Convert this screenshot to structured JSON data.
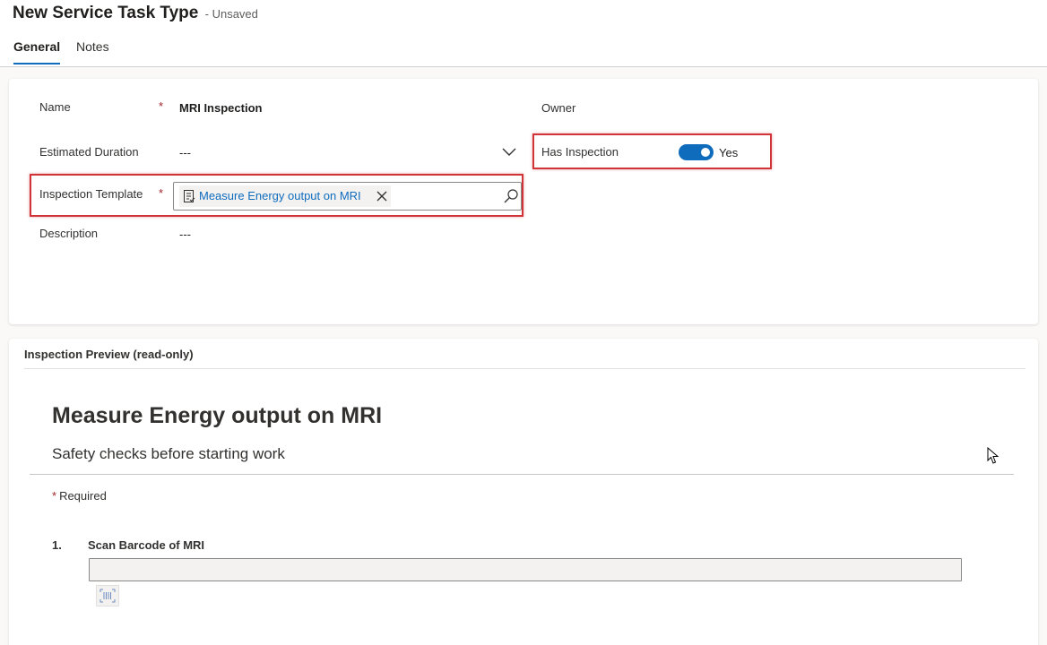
{
  "header": {
    "title": "New Service Task Type",
    "status": "- Unsaved",
    "tabs": [
      {
        "label": "General",
        "active": true
      },
      {
        "label": "Notes",
        "active": false
      }
    ]
  },
  "form": {
    "name": {
      "label": "Name",
      "required_mark": "*",
      "value": "MRI Inspection"
    },
    "owner": {
      "label": "Owner"
    },
    "estimated_duration": {
      "label": "Estimated Duration",
      "value": "---"
    },
    "has_inspection": {
      "label": "Has Inspection",
      "value": "Yes",
      "on": true
    },
    "inspection_template": {
      "label": "Inspection Template",
      "required_mark": "*",
      "value": "Measure Energy output on MRI"
    },
    "description": {
      "label": "Description",
      "value": "---"
    }
  },
  "preview": {
    "header": "Inspection Preview (read-only)",
    "title": "Measure Energy output on MRI",
    "description": "Safety checks before starting work",
    "required_star": "*",
    "required_note": "Required",
    "questions": [
      {
        "number": "1.",
        "title": "Scan Barcode of MRI"
      }
    ]
  },
  "colors": {
    "accent": "#0f6cbd",
    "required": "#a4262c",
    "highlight": "#d13438"
  },
  "icons": {
    "template": "form-template-icon",
    "remove": "close-icon",
    "search": "search-icon",
    "chevron": "chevron-down-icon",
    "barcode": "barcode-scan-icon"
  }
}
